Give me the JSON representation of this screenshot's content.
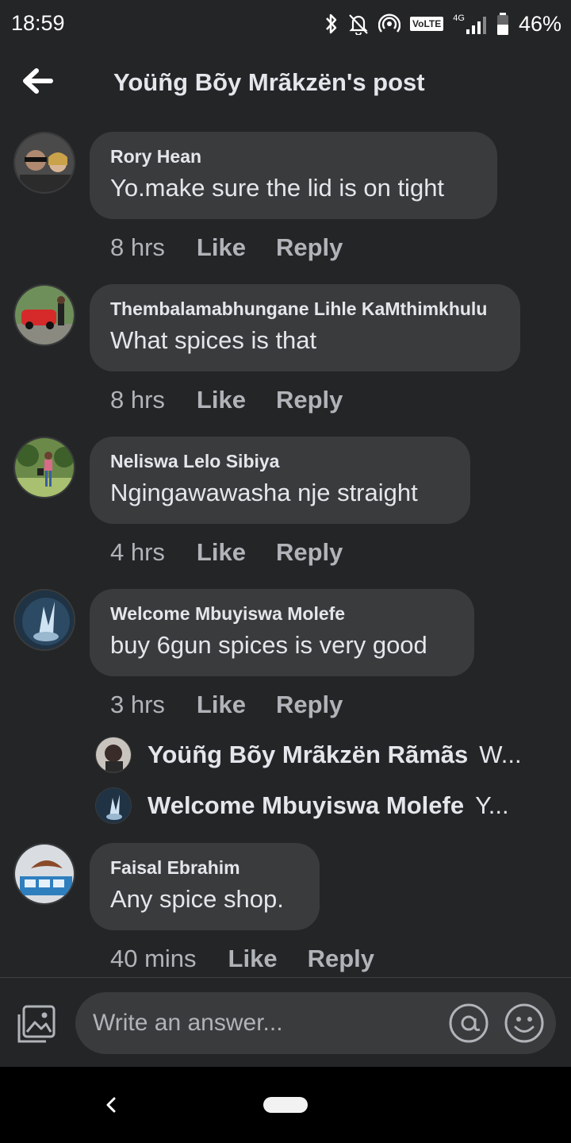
{
  "status_bar": {
    "time": "18:59",
    "volte": "VoLTE",
    "network": "4G",
    "battery": "46%",
    "icons": [
      "bluetooth-icon",
      "notifications-off-icon",
      "hotspot-icon",
      "signal-icon",
      "battery-icon"
    ]
  },
  "header": {
    "title": "Yoüñg Bõy Mrãkzën's post",
    "back_icon": "back-arrow-icon"
  },
  "comments": [
    {
      "author": "Rory Hean",
      "text": "Yo.make sure the lid is on tight",
      "time": "8 hrs",
      "like": "Like",
      "reply": "Reply"
    },
    {
      "author": "Thembalamabhungane Lihle KaMthimkhulu",
      "text": "What spices is that",
      "time": "8 hrs",
      "like": "Like",
      "reply": "Reply"
    },
    {
      "author": "Neliswa Lelo Sibiya",
      "text": "Ngingawawasha nje straight",
      "time": "4 hrs",
      "like": "Like",
      "reply": "Reply"
    },
    {
      "author": "Welcome Mbuyiswa Molefe",
      "text": "buy 6gun spices is very good",
      "time": "3 hrs",
      "like": "Like",
      "reply": "Reply"
    },
    {
      "author": "Faisal Ebrahim",
      "text": "Any spice shop.",
      "time": "40 mins",
      "like": "Like",
      "reply": "Reply"
    }
  ],
  "replies": [
    {
      "author": "Yoüñg Bõy Mrãkzën Rãmãs",
      "snippet": "W..."
    },
    {
      "author": "Welcome Mbuyiswa Molefe",
      "snippet": "Y..."
    }
  ],
  "composer": {
    "placeholder": "Write an answer...",
    "icons": [
      "photo-icon",
      "mention-icon",
      "emoji-icon"
    ]
  },
  "colors": {
    "background": "#242526",
    "bubble": "#3a3b3c",
    "primary_text": "#e4e6eb",
    "secondary_text": "#b0b3b8"
  }
}
